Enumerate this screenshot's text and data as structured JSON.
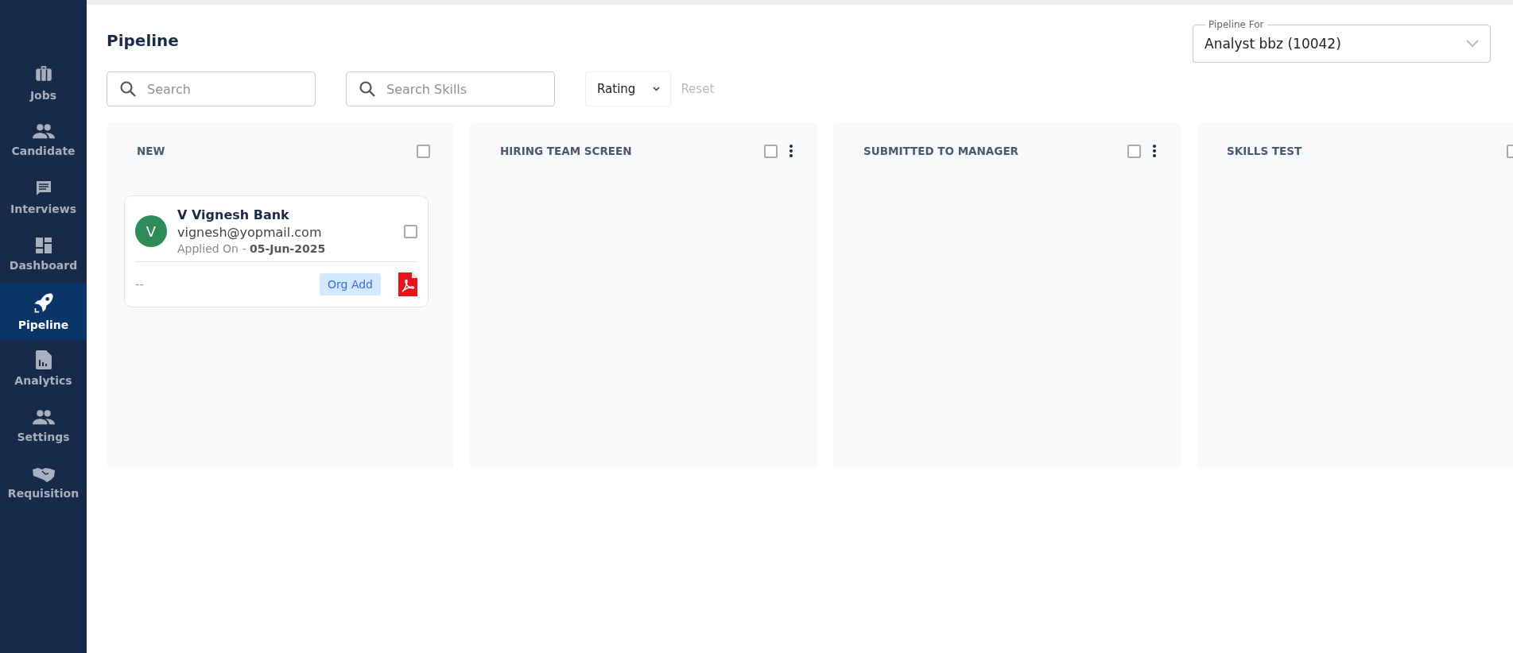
{
  "sidebar": {
    "items": [
      {
        "label": "Jobs",
        "selected": false
      },
      {
        "label": "Candidate",
        "selected": false
      },
      {
        "label": "Interviews",
        "selected": false
      },
      {
        "label": "Dashboard",
        "selected": false
      },
      {
        "label": "Pipeline",
        "selected": true
      },
      {
        "label": "Analytics",
        "selected": false
      },
      {
        "label": "Settings",
        "selected": false
      },
      {
        "label": "Requisition",
        "selected": false
      }
    ]
  },
  "page_title": "Pipeline",
  "pipeline_for": {
    "label": "Pipeline For",
    "value": "Analyst bbz (10042)"
  },
  "filters": {
    "search": {
      "placeholder": "Search"
    },
    "skills": {
      "placeholder": "Search Skills"
    },
    "rating": "Rating",
    "reset": "Reset"
  },
  "columns": [
    {
      "title": "NEW",
      "checked": false,
      "menu": false,
      "cards": [
        {
          "initial": "V",
          "name": "V Vignesh Bank",
          "email": "vignesh@yopmail.com",
          "applied_label": "Applied On - ",
          "applied_date": "05-Jun-2025",
          "checked": false,
          "note": "--",
          "tag": "Org Add"
        }
      ]
    },
    {
      "title": "HIRING TEAM SCREEN",
      "checked": false,
      "menu": true
    },
    {
      "title": "SUBMITTED TO MANAGER",
      "checked": false,
      "menu": true
    },
    {
      "title": "SKILLS TEST",
      "checked": false,
      "menu": false
    }
  ]
}
